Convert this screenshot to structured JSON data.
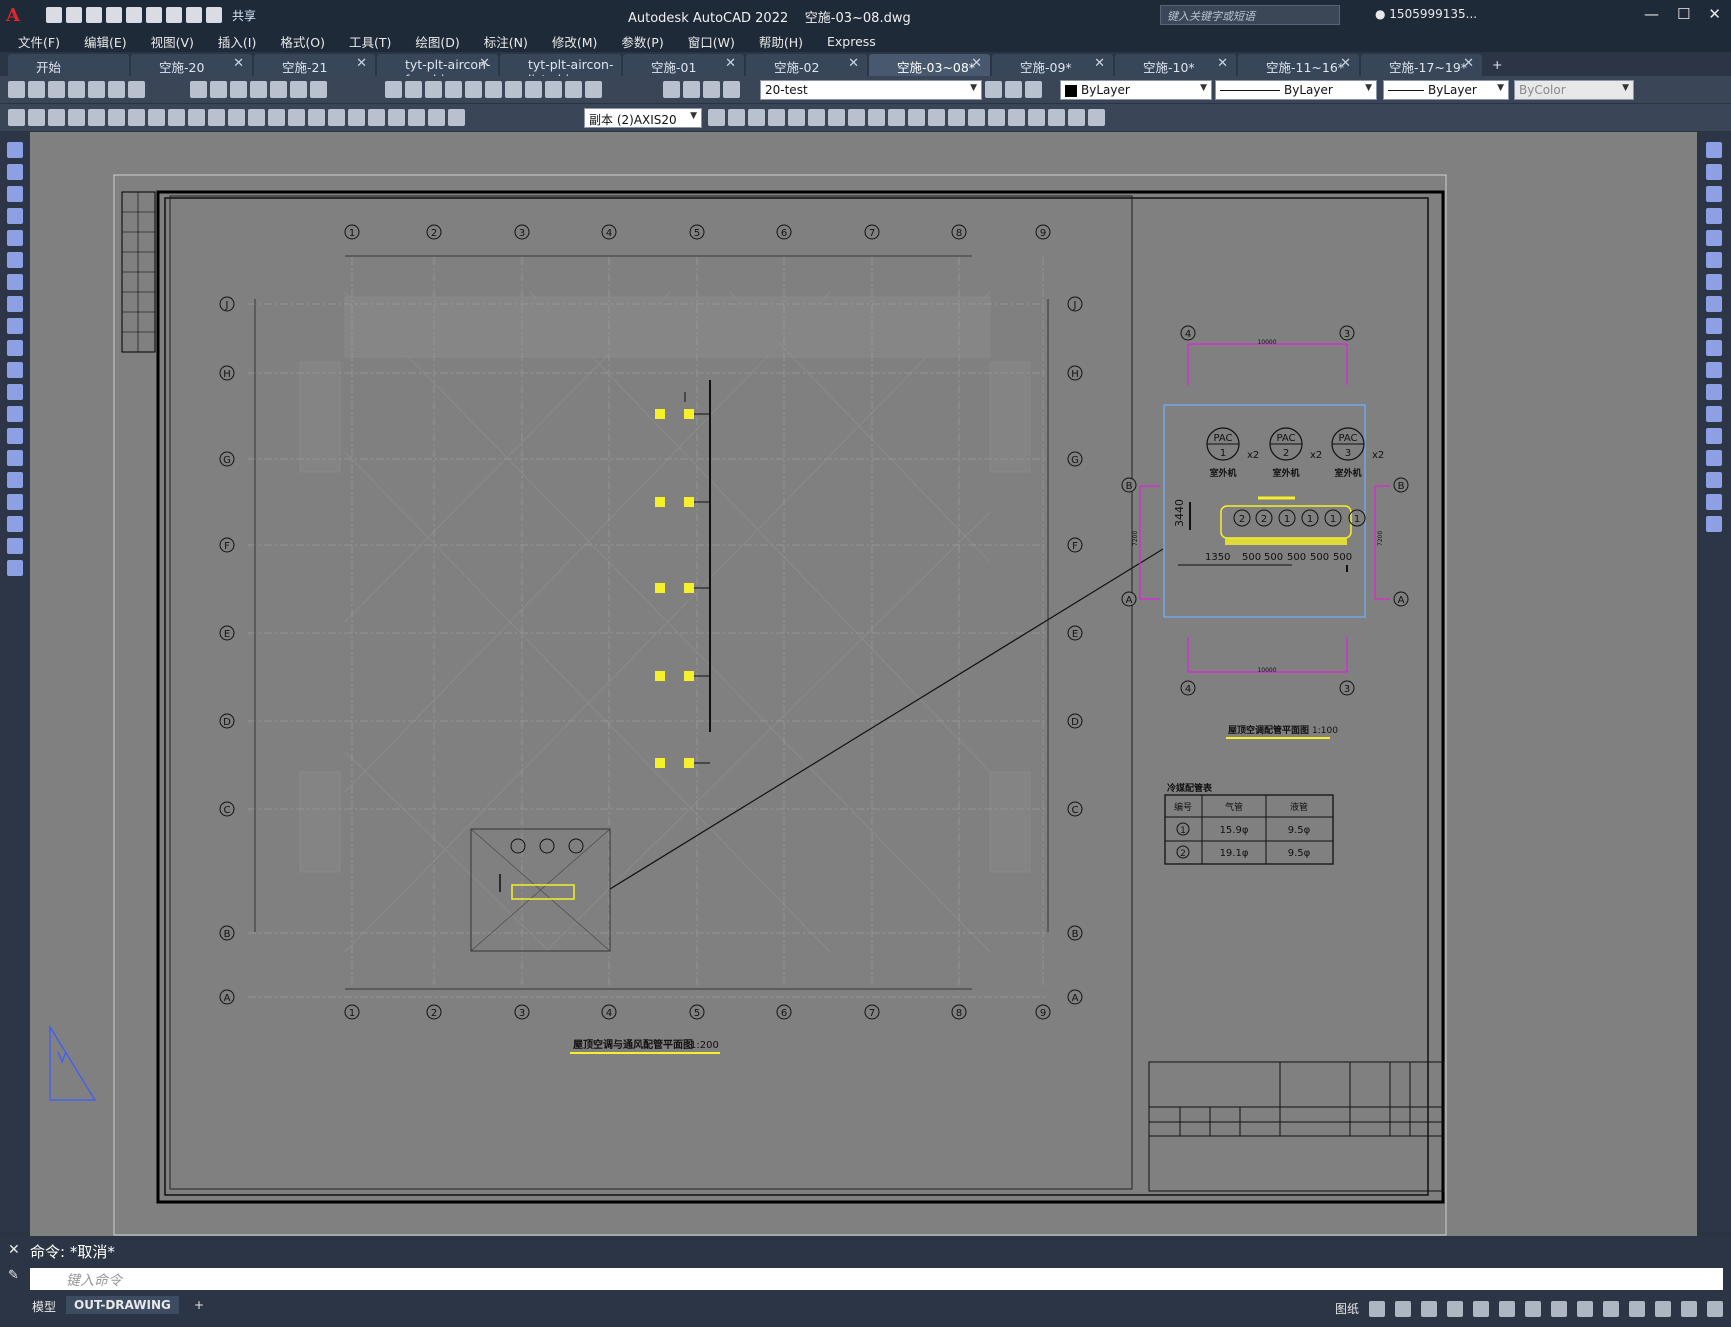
{
  "app": {
    "title": "Autodesk AutoCAD 2022",
    "filename": "空施-03~08.dwg",
    "share_label": "共享",
    "search_placeholder": "键入关键字或短语",
    "user": "1505999135..."
  },
  "menu": [
    "文件(F)",
    "编辑(E)",
    "视图(V)",
    "插入(I)",
    "格式(O)",
    "工具(T)",
    "绘图(D)",
    "标注(N)",
    "修改(M)",
    "参数(P)",
    "窗口(W)",
    "帮助(H)",
    "Express"
  ],
  "tabs": [
    {
      "label": "开始",
      "closable": false
    },
    {
      "label": "空施-20",
      "closable": true
    },
    {
      "label": "空施-21",
      "closable": true
    },
    {
      "label": "tyt-plt-aircon-fm-china",
      "closable": true
    },
    {
      "label": "tyt-plt-aircon-list-china",
      "closable": false
    },
    {
      "label": "空施-01",
      "closable": true
    },
    {
      "label": "空施-02",
      "closable": true
    },
    {
      "label": "空施-03~08*",
      "closable": true,
      "active": true
    },
    {
      "label": "空施-09*",
      "closable": true
    },
    {
      "label": "空施-10*",
      "closable": true
    },
    {
      "label": "空施-11~16*",
      "closable": true
    },
    {
      "label": "空施-17~19*",
      "closable": true
    }
  ],
  "toolbar": {
    "layer": "20-test",
    "color": "ByLayer",
    "linetype": "ByLayer",
    "lineweight": "ByLayer",
    "plotstyle": "ByColor",
    "dimstyle": "副本 (2)AXIS20"
  },
  "drawing": {
    "axes_top": [
      "1",
      "2",
      "3",
      "4",
      "5",
      "6",
      "7",
      "8",
      "9"
    ],
    "axes_side": [
      "J",
      "H",
      "G",
      "F",
      "E",
      "D",
      "C",
      "B",
      "A"
    ],
    "main_title": "屋顶空调与通风配管平面图",
    "main_scale": "1:200",
    "detail_title": "屋顶空调配管平面图",
    "detail_scale": "1:100",
    "detail_axes": {
      "left_top": "4",
      "right_top": "3",
      "upper": "B",
      "lower": "A",
      "dim": "10000",
      "side_dim": "7200"
    },
    "pac_units": [
      {
        "label": "PAC",
        "num": "1",
        "qty": "x2",
        "caption": "室外机"
      },
      {
        "label": "PAC",
        "num": "2",
        "qty": "x2",
        "caption": "室外机"
      },
      {
        "label": "PAC",
        "num": "3",
        "qty": "x2",
        "caption": "室外机"
      }
    ],
    "detail_circles": [
      "2",
      "2",
      "1",
      "1",
      "1",
      "1"
    ],
    "detail_dims": [
      "1350",
      "500",
      "500",
      "500",
      "500",
      "500"
    ],
    "detail_vertical_dim": "3440",
    "pipe_table": {
      "title": "冷媒配管表",
      "headers": [
        "编号",
        "气管",
        "液管"
      ],
      "rows": [
        [
          "1",
          "15.9φ",
          "9.5φ"
        ],
        [
          "2",
          "19.1φ",
          "9.5φ"
        ]
      ]
    }
  },
  "command": {
    "last": "命令: *取消*",
    "placeholder": "键入命令"
  },
  "layouts": [
    "模型",
    "OUT-DRAWING"
  ],
  "status": {
    "paper_label": "图纸"
  },
  "colors": {
    "accent": "#e0262b",
    "magenta": "#e020e0",
    "yellow": "#f5f02a",
    "detail_frame": "#6fb0ff"
  }
}
